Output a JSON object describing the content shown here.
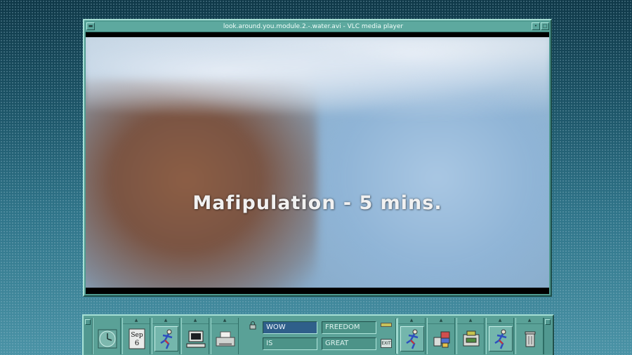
{
  "window": {
    "title": "look.around.you.module.2.-.water.avi - VLC media player",
    "menu_icon": "window-menu-icon",
    "minimize_icon": "minimize-icon",
    "maximize_icon": "maximize-icon"
  },
  "video": {
    "subtitle": "Mafipulation - 5 mins."
  },
  "front_panel": {
    "left_launchers": [
      {
        "name": "clock-icon"
      },
      {
        "name": "calendar-icon",
        "month": "Sep",
        "day": "6"
      },
      {
        "name": "running-man-icon"
      },
      {
        "name": "workstation-icon"
      },
      {
        "name": "printer-icon"
      }
    ],
    "workspaces": [
      "WOW",
      "IS",
      "FREEDOM",
      "GREAT"
    ],
    "selected_workspace": "WOW",
    "exit_label": "EXIT",
    "right_launchers": [
      {
        "name": "running-man-icon"
      },
      {
        "name": "style-manager-icon"
      },
      {
        "name": "app-manager-icon"
      },
      {
        "name": "running-man-icon"
      },
      {
        "name": "trash-icon"
      }
    ]
  },
  "colors": {
    "window_frame": "#4f9a90",
    "workspace_selected": "#2f5f8a",
    "workspace_unselected": "#4c9388"
  }
}
